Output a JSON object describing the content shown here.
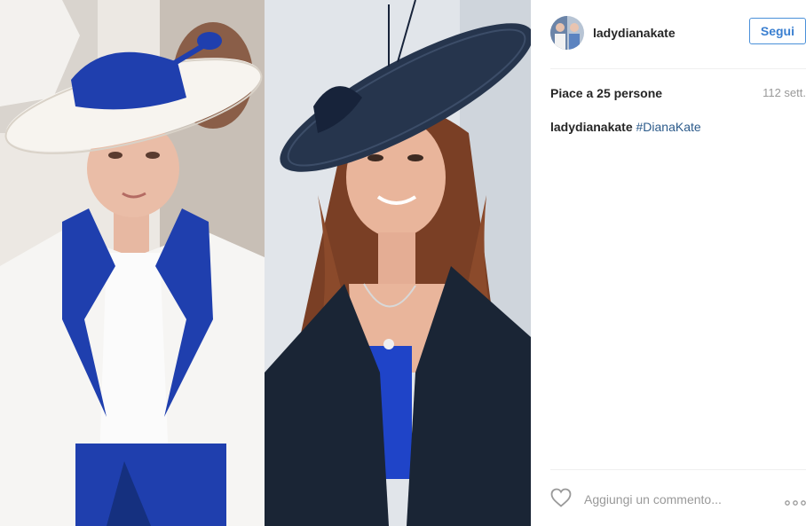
{
  "post": {
    "username": "ladydianakate",
    "follow_label": "Segui",
    "likes": "Piace a 25 persone",
    "age": "112 sett.",
    "caption": {
      "username": "ladydianakate",
      "hashtag": "#DianaKate"
    },
    "comment_placeholder": "Aggiungi un commento..."
  },
  "icons": {
    "like": "heart-icon",
    "more": "more-options-icon"
  },
  "colors": {
    "follow_accent": "#3a7fd0",
    "hashtag": "#2b5a8a",
    "royal_blue": "#1f3fae",
    "navy": "#1e2a3c"
  }
}
